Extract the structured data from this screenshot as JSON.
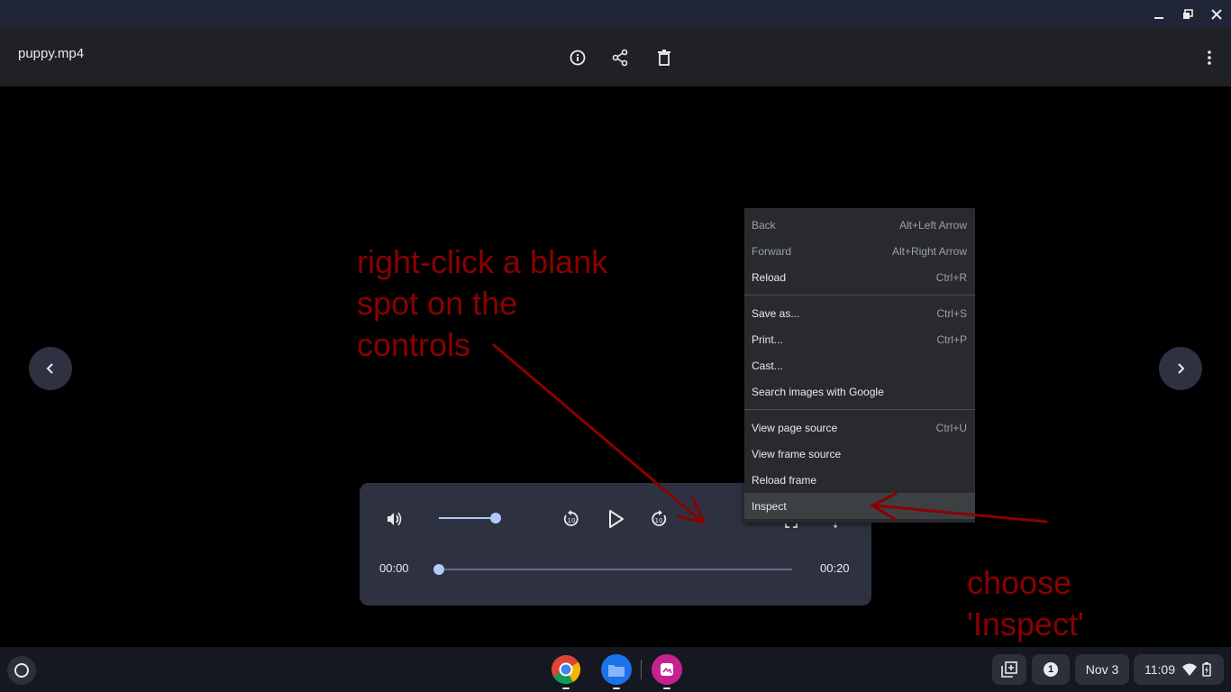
{
  "header": {
    "title": "puppy.mp4"
  },
  "player": {
    "time_current": "00:00",
    "time_total": "00:20",
    "volume_level": 1.0,
    "progress": 0.0
  },
  "context_menu": {
    "items": [
      {
        "label": "Back",
        "shortcut": "Alt+Left Arrow"
      },
      {
        "label": "Forward",
        "shortcut": "Alt+Right Arrow"
      },
      {
        "label": "Reload",
        "shortcut": "Ctrl+R"
      },
      {
        "label": "Save as...",
        "shortcut": "Ctrl+S"
      },
      {
        "label": "Print...",
        "shortcut": "Ctrl+P"
      },
      {
        "label": "Cast...",
        "shortcut": ""
      },
      {
        "label": "Search images with Google",
        "shortcut": ""
      },
      {
        "label": "View page source",
        "shortcut": "Ctrl+U"
      },
      {
        "label": "View frame source",
        "shortcut": ""
      },
      {
        "label": "Reload frame",
        "shortcut": ""
      },
      {
        "label": "Inspect",
        "shortcut": ""
      }
    ]
  },
  "annotations": {
    "step1": [
      "right-click a blank",
      "spot on the",
      "controls"
    ],
    "step2": [
      "choose",
      "'Inspect'"
    ]
  },
  "tray": {
    "notification_count": "1",
    "date": "Nov 3",
    "time": "11:09"
  },
  "colors": {
    "annotation": "#8b0000",
    "accent": "#aecbfa",
    "panel": "#2e3240"
  }
}
